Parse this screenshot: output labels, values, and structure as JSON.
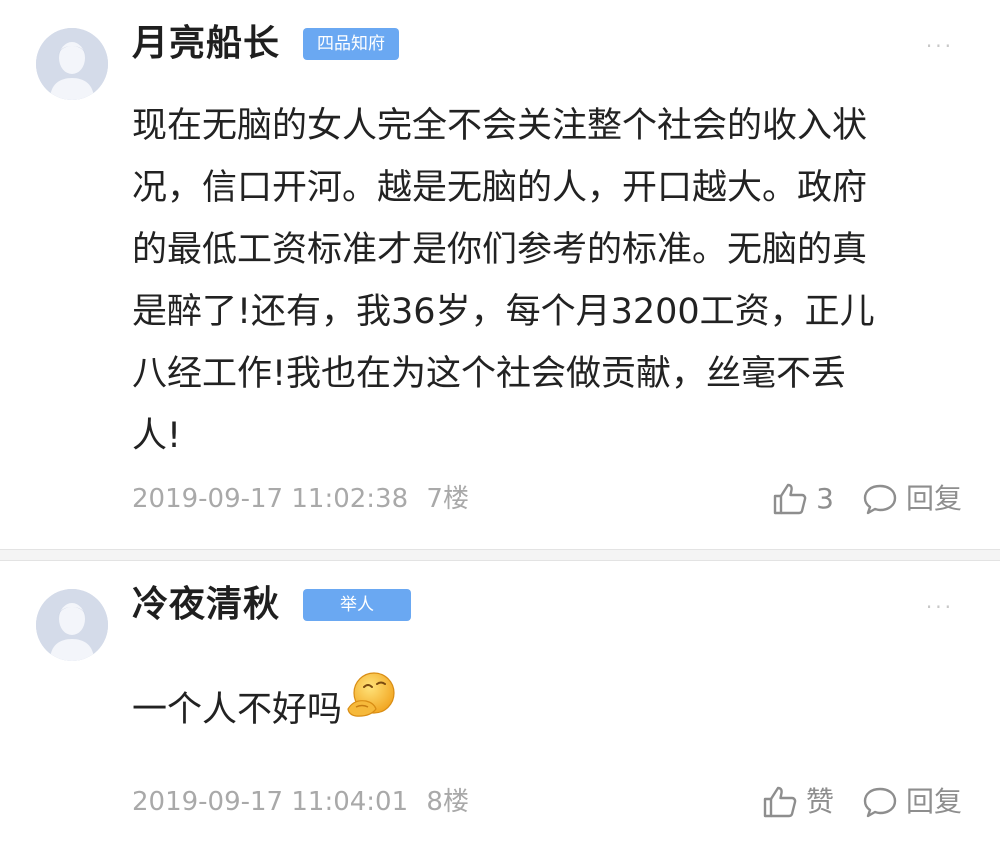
{
  "comments": [
    {
      "username": "月亮船长",
      "badge": "四品知府",
      "more": "···",
      "content": "现在无脑的女人完全不会关注整个社会的收入状况，信口开河。越是无脑的人，开口越大。政府的最低工资标准才是你们参考的标准。无脑的真是醉了!还有，我36岁，每个月3200工资，正儿八经工作!我也在为这个社会做贡献，丝毫不丢人!",
      "content_lines": [
        "现在无脑的女人完全不会关注整个社会的收入状",
        "况，信口开河。越是无脑的人，开口越大。政府",
        "的最低工资标准才是你们参考的标准。无脑的真",
        "是醉了!还有，我36岁，每个月3200工资，正儿",
        "八经工作!我也在为这个社会做贡献，丝毫不丢",
        "人!"
      ],
      "timestamp": "2019-09-17 11:02:38",
      "floor": "7楼",
      "like_label": "3",
      "reply_label": "回复",
      "colors": {
        "badge": "#6aa8f2"
      }
    },
    {
      "username": "冷夜清秋",
      "badge": "举人",
      "more": "···",
      "content": "一个人不好吗",
      "emoji_icon": "thinking-face-emoji-icon",
      "timestamp": "2019-09-17 11:04:01",
      "floor": "8楼",
      "like_label": "赞",
      "reply_label": "回复",
      "colors": {
        "badge": "#6aa8f2"
      }
    }
  ]
}
